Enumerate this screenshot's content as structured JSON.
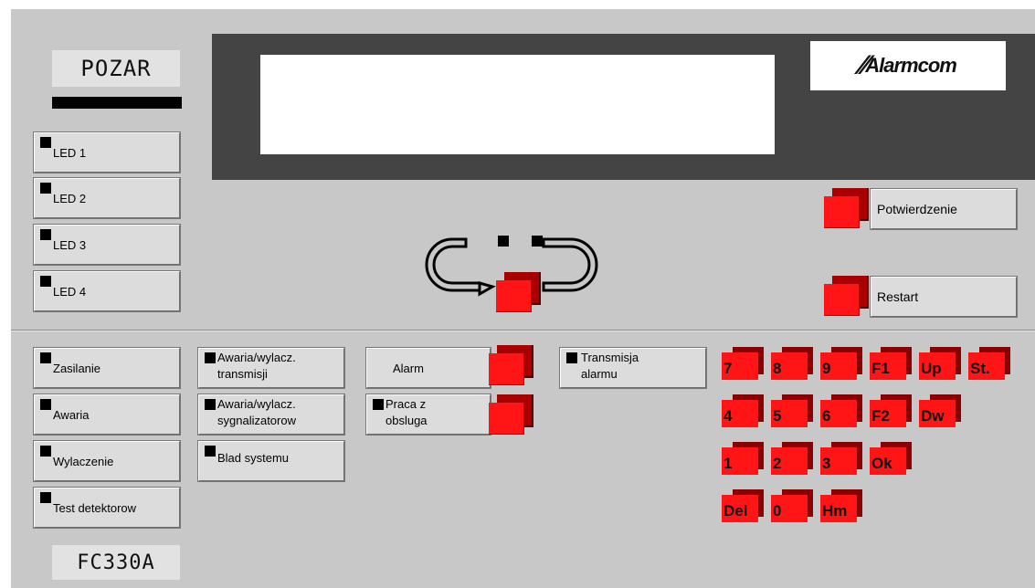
{
  "top": {
    "mode_label": "POZAR",
    "leds": [
      "LED 1",
      "LED 2",
      "LED 3",
      "LED 4"
    ],
    "confirm_label": "Potwierdzenie",
    "restart_label": "Restart"
  },
  "status": {
    "col1": [
      "Zasilanie",
      "Awaria",
      "Wylaczenie",
      "Test detektorow"
    ],
    "col2": [
      {
        "line1": "Awaria/wylacz.",
        "line2": "transmisji"
      },
      {
        "line1": "Awaria/wylacz.",
        "line2": "sygnalizatorow"
      },
      {
        "line1": "Blad systemu",
        "line2": ""
      }
    ],
    "alarm_label": "Alarm",
    "praca": {
      "line1": "Praca z",
      "line2": "obsluga"
    },
    "transmisja": {
      "line1": "Transmisja",
      "line2": "alarmu"
    }
  },
  "keypad": {
    "rows": [
      [
        "7",
        "8",
        "9",
        "F1",
        "Up",
        "St."
      ],
      [
        "4",
        "5",
        "6",
        "F2",
        "Dw"
      ],
      [
        "1",
        "2",
        "3",
        "Ok"
      ],
      [
        "Del",
        "0",
        "Hm"
      ]
    ]
  },
  "model_label": "FC330A",
  "logo_text": "Alarmcom",
  "colors": {
    "panel": "#c8c8c8",
    "screen": "#444444",
    "red": "#ff1515",
    "dark_red": "#a80000"
  }
}
